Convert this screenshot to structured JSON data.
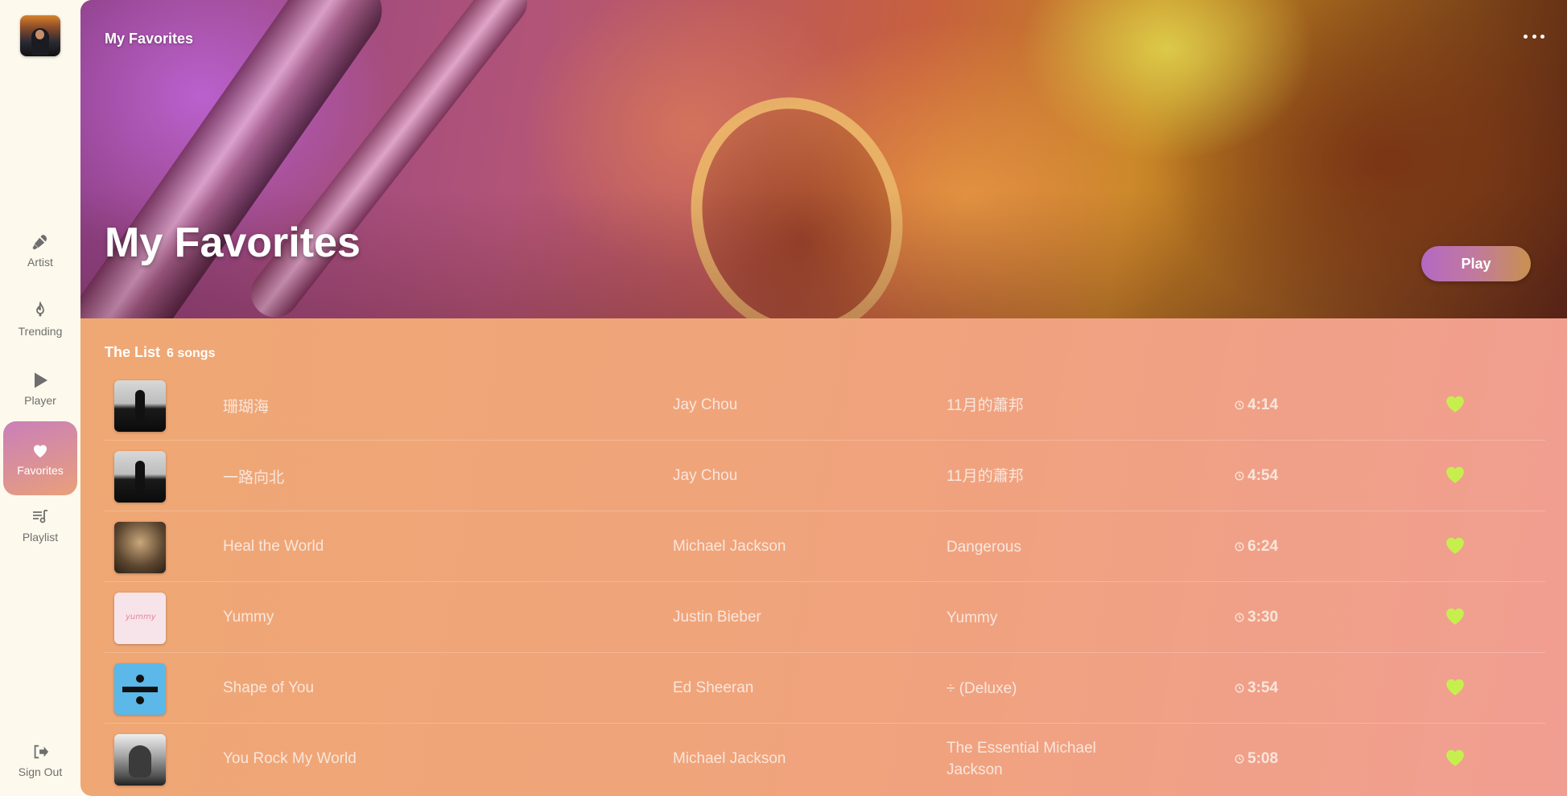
{
  "sidebar": {
    "items": [
      {
        "id": "artist",
        "label": "Artist",
        "icon": "microphone-icon"
      },
      {
        "id": "trending",
        "label": "Trending",
        "icon": "flame-icon"
      },
      {
        "id": "player",
        "label": "Player",
        "icon": "play-icon"
      },
      {
        "id": "favorites",
        "label": "Favorites",
        "icon": "heart-icon",
        "active": true
      },
      {
        "id": "playlist",
        "label": "Playlist",
        "icon": "playlist-icon"
      }
    ],
    "signout_label": "Sign Out"
  },
  "header": {
    "top_title": "My Favorites",
    "hero_title": "My Favorites",
    "play_label": "Play"
  },
  "list": {
    "title": "The List",
    "count": "6 songs",
    "songs": [
      {
        "title": "珊瑚海",
        "artist": "Jay Chou",
        "album": "11月的蕭邦",
        "duration": "4:14",
        "favorite": true
      },
      {
        "title": "一路向北",
        "artist": "Jay Chou",
        "album": "11月的蕭邦",
        "duration": "4:54",
        "favorite": true
      },
      {
        "title": "Heal the World",
        "artist": "Michael Jackson",
        "album": "Dangerous",
        "duration": "6:24",
        "favorite": true
      },
      {
        "title": "Yummy",
        "artist": "Justin Bieber",
        "album": "Yummy",
        "duration": "3:30",
        "favorite": true
      },
      {
        "title": "Shape of You",
        "artist": "Ed Sheeran",
        "album": "÷ (Deluxe)",
        "duration": "3:54",
        "favorite": true
      },
      {
        "title": "You Rock My World",
        "artist": "Michael Jackson",
        "album": "The Essential Michael Jackson",
        "duration": "5:08",
        "favorite": true
      }
    ]
  },
  "colors": {
    "heart": "#c6ef4e",
    "accent": "#c97fb9",
    "text_muted": "#6e6e6e"
  }
}
